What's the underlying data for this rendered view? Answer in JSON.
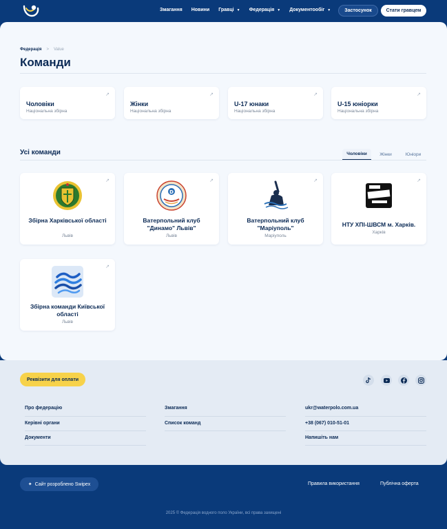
{
  "header": {
    "nav": [
      {
        "label": "Змагання",
        "has_menu": false
      },
      {
        "label": "Новини",
        "has_menu": false
      },
      {
        "label": "Гравці",
        "has_menu": true
      },
      {
        "label": "Федерація",
        "has_menu": true
      },
      {
        "label": "Документообіг",
        "has_menu": true
      }
    ],
    "apply_label": "Застосунок",
    "join_label": "Стати гравцем"
  },
  "breadcrumb": {
    "parent": "Федерація",
    "separator": ">",
    "current": "Value"
  },
  "page_title": "Команди",
  "national_teams": [
    {
      "title": "Чоловіки",
      "subtitle": "Національна збірна"
    },
    {
      "title": "Жінки",
      "subtitle": "Національна збірна"
    },
    {
      "title": "U-17 юнаки",
      "subtitle": "Національна збірна"
    },
    {
      "title": "U-15 юніорки",
      "subtitle": "Національна збірна"
    }
  ],
  "all_teams": {
    "title": "Усі команди",
    "tabs": [
      {
        "label": "Чоловіки",
        "active": true
      },
      {
        "label": "Жінки",
        "active": false
      },
      {
        "label": "Юніори",
        "active": false
      }
    ],
    "teams": [
      {
        "name": "Збірна Харківської області",
        "city": "Львів",
        "logo": "kharkiv-coat-of-arms"
      },
      {
        "name": "Ватерпольний клуб \"Динамо\" Львів\"",
        "city": "Львів",
        "logo": "dynamo-emblem"
      },
      {
        "name": "Ватерпольний клуб \"Маріуполь\"",
        "city": "Маріуполь",
        "logo": "waterpolo-player-emblem"
      },
      {
        "name": "НТУ ХПІ-ШВСМ м. Харків.",
        "city": "Харків",
        "logo": "khpi-stamp"
      },
      {
        "name": "Збірна команди Київської області",
        "city": "Львів",
        "logo": "wave-emblem"
      }
    ]
  },
  "footer": {
    "pay_label": "Реквізити для оплати",
    "socials": [
      "tiktok-icon",
      "youtube-icon",
      "facebook-icon",
      "instagram-icon"
    ],
    "col1": [
      "Про федерацію",
      "Керівні органи",
      "Документи"
    ],
    "col2": [
      "Змагання",
      "Список команд"
    ],
    "col3": [
      "ukr@waterpolo.com.ua",
      "+38 (067) 010-51-01",
      "Напишіть нам"
    ],
    "credit": "Сайт розроблено Swipex",
    "credit_mark": "✦",
    "rules": "Правила використання",
    "offer": "Публічна оферта",
    "copyright": "2025 © Федерація водного поло України, всі права захищені"
  },
  "colors": {
    "navy": "#0a3a7a",
    "accent_yellow": "#f7d24a",
    "panel": "#f4f8fd"
  }
}
